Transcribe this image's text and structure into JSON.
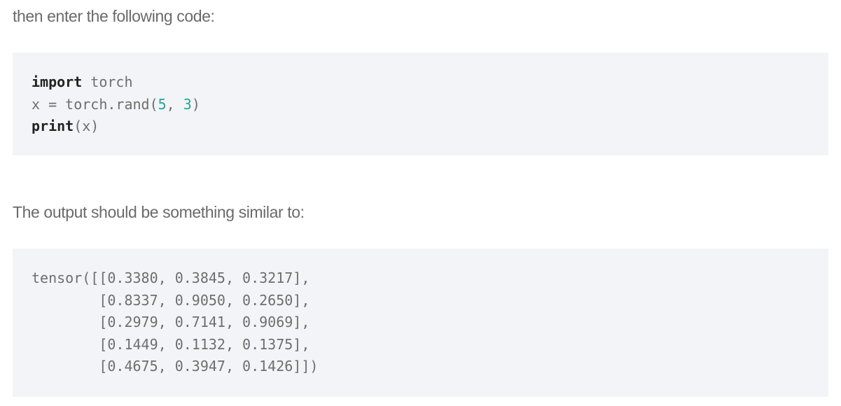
{
  "intro_text": "then enter the following code:",
  "code_input": {
    "line1": {
      "keyword": "import",
      "rest": " torch"
    },
    "line2": {
      "prefix": "x = torch.rand(",
      "num1": "5",
      "sep": ", ",
      "num2": "3",
      "suffix": ")"
    },
    "line3": {
      "keyword": "print",
      "rest": "(x)"
    }
  },
  "output_intro_text": "The output should be something similar to:",
  "code_output": {
    "lines": [
      "tensor([[0.3380, 0.3845, 0.3217],",
      "        [0.8337, 0.9050, 0.2650],",
      "        [0.2979, 0.7141, 0.9069],",
      "        [0.1449, 0.1132, 0.1375],",
      "        [0.4675, 0.3947, 0.1426]])"
    ]
  }
}
